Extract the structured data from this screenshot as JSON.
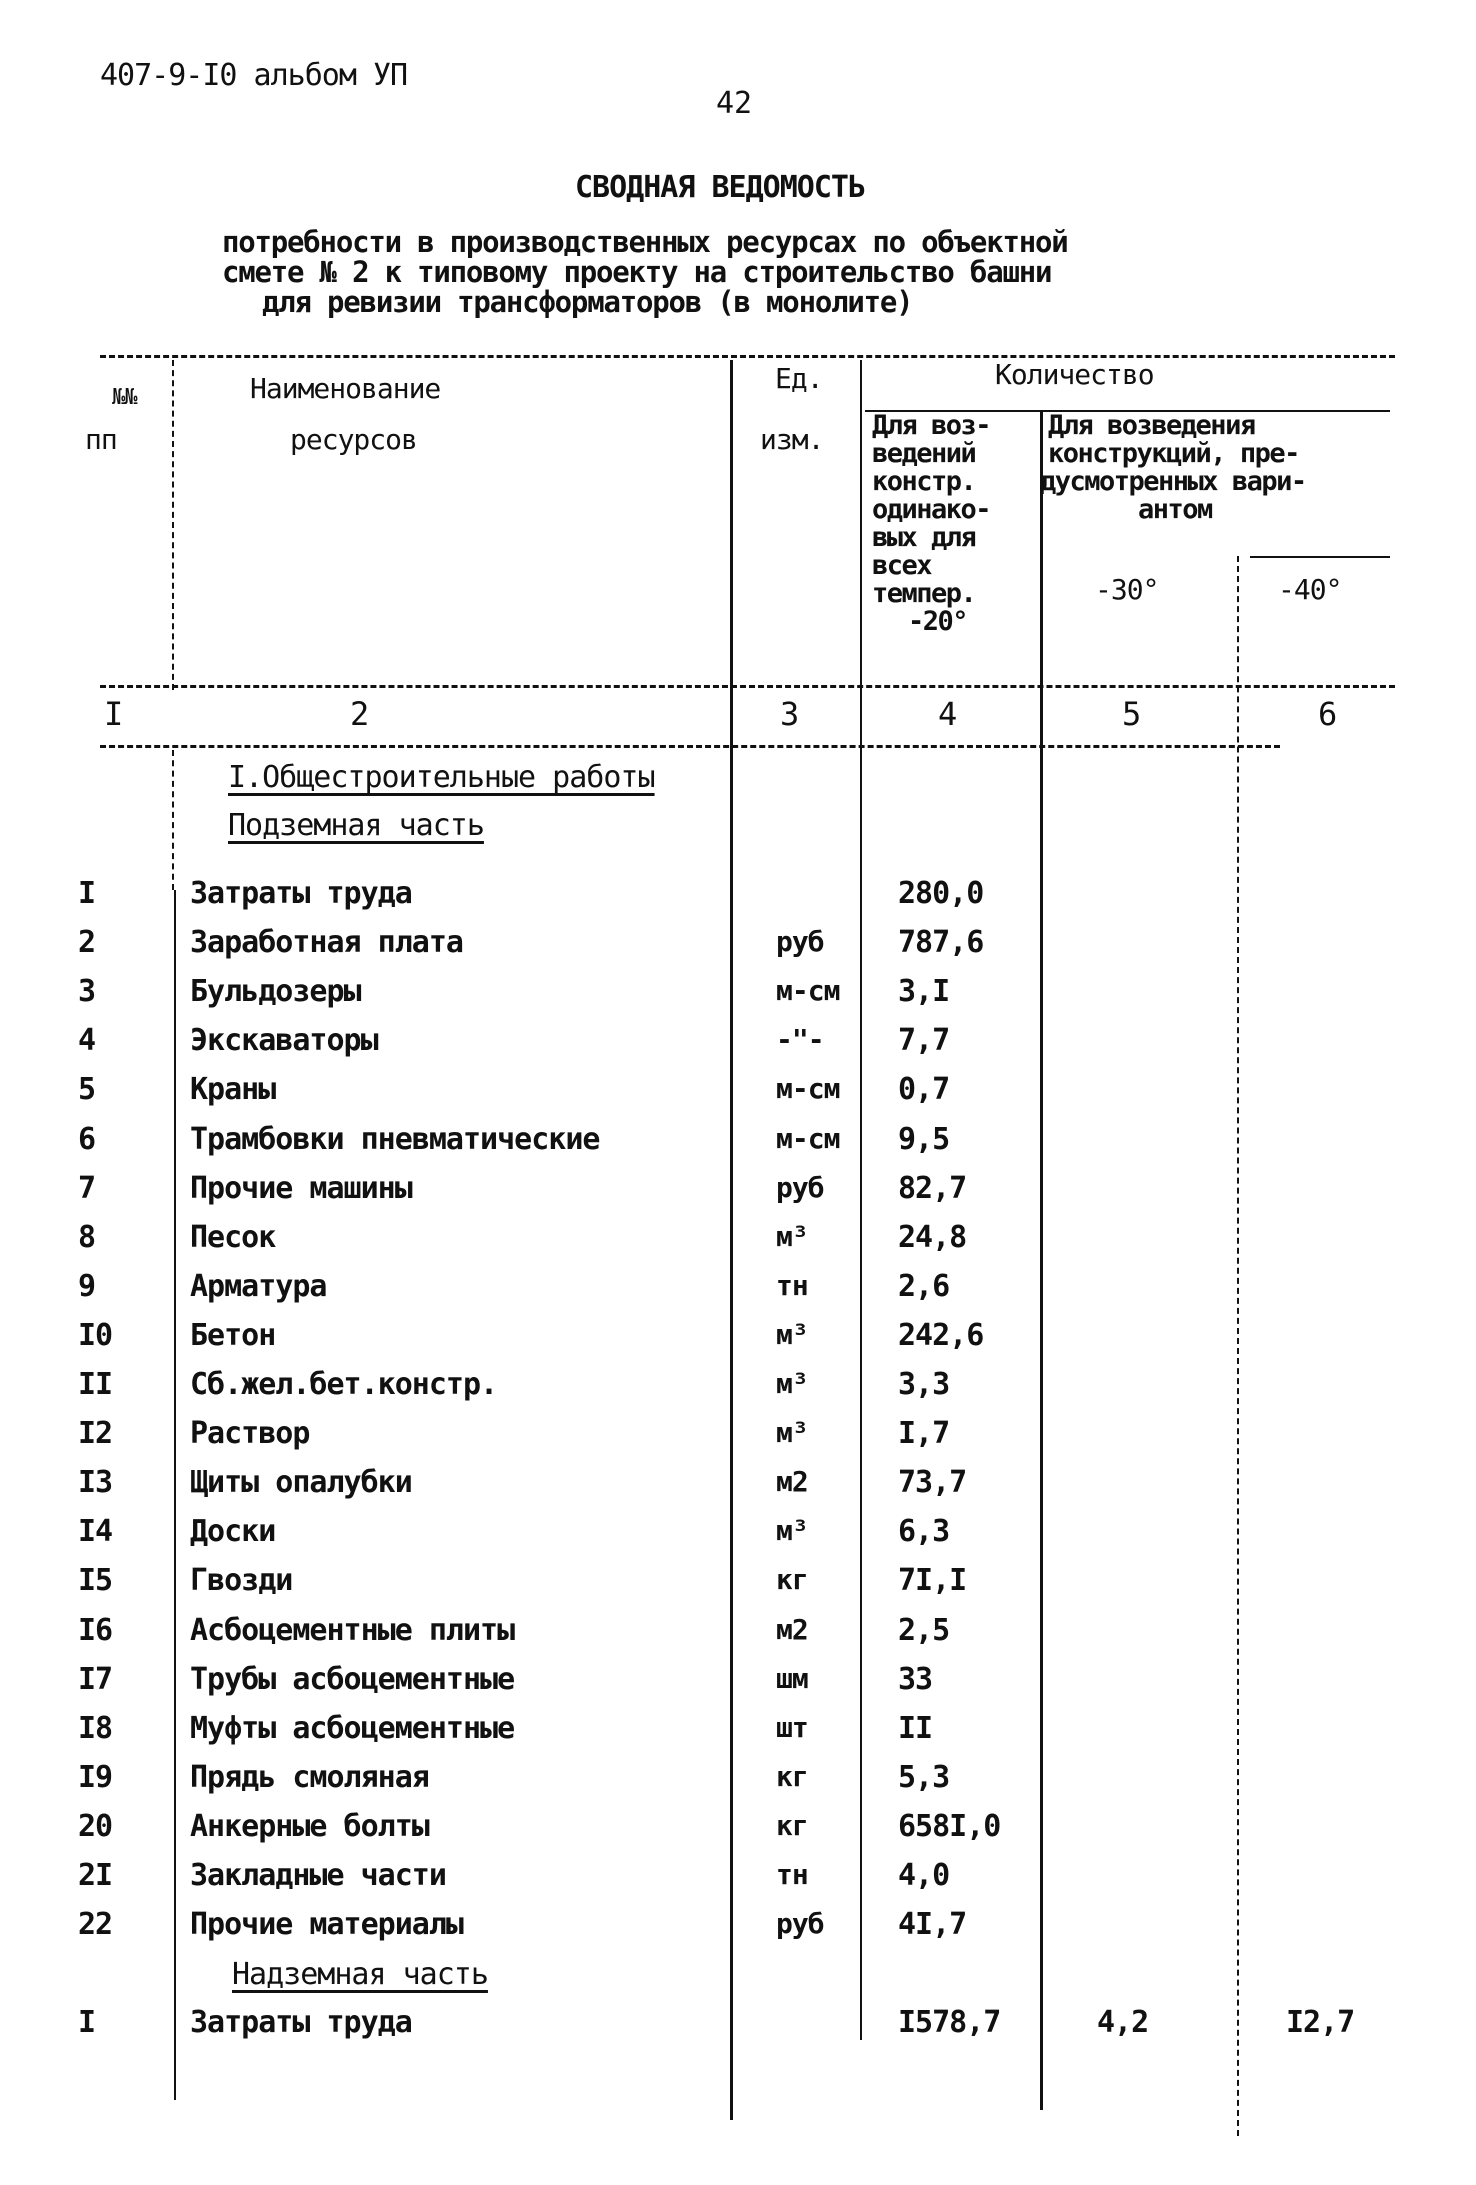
{
  "header": {
    "doc_code": "407-9-I0 альбом УП",
    "page_number": "42",
    "title": "СВОДНАЯ ВЕДОМОСТЬ",
    "subtitle_lines": [
      "потребности в производственных ресурсах по объектной",
      "смете № 2 к типовому проекту на строительство башни",
      "для ревизии трансформаторов (в монолите)"
    ]
  },
  "table": {
    "columns": {
      "num_line1": "№№",
      "num_line2": "пп",
      "name_line1": "Наименование",
      "name_line2": "ресурсов",
      "unit_line1": "Ед.",
      "unit_line2": "изм.",
      "quantity": "Количество",
      "q_common_lines": [
        "Для воз-",
        "ведений",
        "констр.",
        "одинако-",
        "вых для",
        "всех",
        "темпер.",
        "-20°"
      ],
      "q_variant_lines": [
        "Для возведения",
        "конструкций, пре-",
        "дусмотренных вари-",
        "антом"
      ],
      "q_minus30": "-30°",
      "q_minus40": "-40°"
    },
    "column_numbers": [
      "I",
      "2",
      "3",
      "4",
      "5",
      "6"
    ],
    "section_title": "I.Общестроительные работы",
    "subsection_underground": "Подземная часть",
    "subsection_aboveground": "Надземная часть",
    "underground_rows": [
      {
        "num": "I",
        "name": "Затраты труда",
        "unit": "",
        "q4": "280,0",
        "q5": "",
        "q6": ""
      },
      {
        "num": "2",
        "name": "Заработная плата",
        "unit": "руб",
        "q4": "787,6",
        "q5": "",
        "q6": ""
      },
      {
        "num": "3",
        "name": "Бульдозеры",
        "unit": "м-см",
        "q4": "3,I",
        "q5": "",
        "q6": ""
      },
      {
        "num": "4",
        "name": "Экскаваторы",
        "unit": "-\"-",
        "q4": "7,7",
        "q5": "",
        "q6": ""
      },
      {
        "num": "5",
        "name": "Краны",
        "unit": "м-см",
        "q4": "0,7",
        "q5": "",
        "q6": ""
      },
      {
        "num": "6",
        "name": "Трамбовки пневматические",
        "unit": "м-см",
        "q4": "9,5",
        "q5": "",
        "q6": ""
      },
      {
        "num": "7",
        "name": "Прочие машины",
        "unit": "руб",
        "q4": "82,7",
        "q5": "",
        "q6": ""
      },
      {
        "num": "8",
        "name": "Песок",
        "unit": "м³",
        "q4": "24,8",
        "q5": "",
        "q6": ""
      },
      {
        "num": "9",
        "name": "Арматура",
        "unit": "тн",
        "q4": "2,6",
        "q5": "",
        "q6": ""
      },
      {
        "num": "I0",
        "name": "Бетон",
        "unit": "м³",
        "q4": "242,6",
        "q5": "",
        "q6": ""
      },
      {
        "num": "II",
        "name": "Сб.жел.бет.констр.",
        "unit": "м³",
        "q4": "3,3",
        "q5": "",
        "q6": ""
      },
      {
        "num": "I2",
        "name": "Раствор",
        "unit": "м³",
        "q4": "I,7",
        "q5": "",
        "q6": ""
      },
      {
        "num": "I3",
        "name": "Щиты опалубки",
        "unit": "м2",
        "q4": "73,7",
        "q5": "",
        "q6": ""
      },
      {
        "num": "I4",
        "name": "Доски",
        "unit": "м³",
        "q4": "6,3",
        "q5": "",
        "q6": ""
      },
      {
        "num": "I5",
        "name": "Гвозди",
        "unit": "кг",
        "q4": "7I,I",
        "q5": "",
        "q6": ""
      },
      {
        "num": "I6",
        "name": "Асбоцементные плиты",
        "unit": "м2",
        "q4": "2,5",
        "q5": "",
        "q6": ""
      },
      {
        "num": "I7",
        "name": "Трубы асбоцементные",
        "unit": "шм",
        "q4": "33",
        "q5": "",
        "q6": ""
      },
      {
        "num": "I8",
        "name": "Муфты асбоцементные",
        "unit": "шт",
        "q4": "II",
        "q5": "",
        "q6": ""
      },
      {
        "num": "I9",
        "name": "Прядь смоляная",
        "unit": "кг",
        "q4": "5,3",
        "q5": "",
        "q6": ""
      },
      {
        "num": "20",
        "name": "Анкерные болты",
        "unit": "кг",
        "q4": "658I,0",
        "q5": "",
        "q6": ""
      },
      {
        "num": "2I",
        "name": "Закладные части",
        "unit": "тн",
        "q4": "4,0",
        "q5": "",
        "q6": ""
      },
      {
        "num": "22",
        "name": "Прочие материалы",
        "unit": "руб",
        "q4": "4I,7",
        "q5": "",
        "q6": ""
      }
    ],
    "aboveground_rows": [
      {
        "num": "I",
        "name": "Затраты труда",
        "unit": "",
        "q4": "I578,7",
        "q5": "4,2",
        "q6": "I2,7"
      }
    ]
  }
}
